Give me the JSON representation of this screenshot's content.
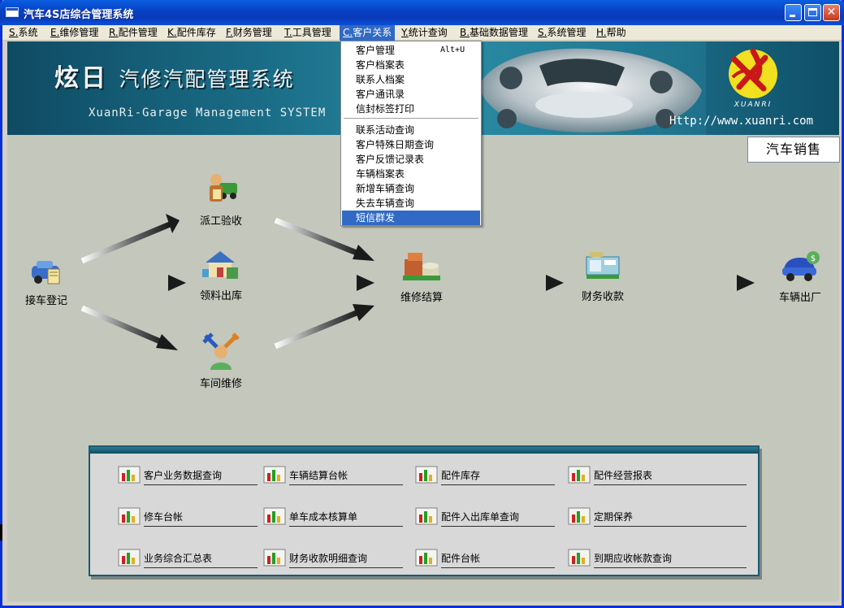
{
  "window": {
    "title": "汽车4S店综合管理系统"
  },
  "menubar": [
    {
      "key": "S.",
      "label": "系统"
    },
    {
      "key": "E.",
      "label": "维修管理"
    },
    {
      "key": "R.",
      "label": "配件管理"
    },
    {
      "key": "K.",
      "label": "配件库存"
    },
    {
      "key": "F.",
      "label": "财务管理"
    },
    {
      "key": "T.",
      "label": "工具管理"
    },
    {
      "key": "C.",
      "label": "客户关系"
    },
    {
      "key": "Y.",
      "label": "统计查询"
    },
    {
      "key": "B.",
      "label": "基础数据管理"
    },
    {
      "key": "S.",
      "label": "系统管理"
    },
    {
      "key": "H.",
      "label": "帮助"
    }
  ],
  "dropdown": {
    "items": [
      {
        "label": "客户管理",
        "accel": "Alt+U"
      },
      {
        "label": "客户档案表"
      },
      {
        "label": "联系人档案"
      },
      {
        "label": "客户通讯录"
      },
      {
        "label": "信封标签打印"
      },
      {
        "label": "联系活动查询"
      },
      {
        "label": "客户特殊日期查询"
      },
      {
        "label": "客户反馈记录表"
      },
      {
        "label": "车辆档案表"
      },
      {
        "label": "新增车辆查询"
      },
      {
        "label": "失去车辆查询"
      },
      {
        "label": "短信群发"
      }
    ]
  },
  "banner": {
    "title_big": "炫日",
    "title_rest": "汽修汽配管理系统",
    "subtitle": "XuanRi-Garage Management SYSTEM",
    "url": "Http://www.xuanri.com",
    "logo_text": "XUANRI",
    "sales_button": "汽车销售"
  },
  "flow": {
    "reception": "接车登记",
    "dispatch": "派工验收",
    "parts_out": "领料出库",
    "workshop": "车间维修",
    "settlement": "维修结算",
    "payment": "财务收款",
    "exit": "车辆出厂"
  },
  "reports": [
    "客户业务数据查询",
    "车辆结算台帐",
    "配件库存",
    "配件经营报表",
    "修车台帐",
    "单车成本核算单",
    "配件入出库单查询",
    "定期保养",
    "业务综合汇总表",
    "财务收款明细查询",
    "配件台帐",
    "到期应收帐款查询"
  ],
  "colors": {
    "menu_highlight": "#316ac5",
    "banner": "#1a6c86",
    "client_bg": "#c3c7bc"
  }
}
